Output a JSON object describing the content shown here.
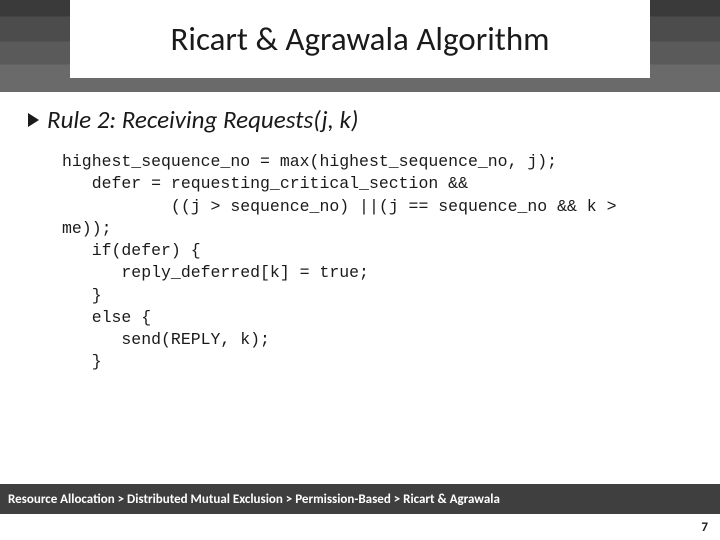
{
  "title": "Ricart & Agrawala Algorithm",
  "subhead": "Rule 2: Receiving Requests(j, k)",
  "code": "highest_sequence_no = max(highest_sequence_no, j);\n   defer = requesting_critical_section &&\n           ((j > sequence_no) ||(j == sequence_no && k >\nme));\n   if(defer) {\n      reply_deferred[k] = true;\n   }\n   else {\n      send(REPLY, k);\n   }",
  "breadcrumb": "Resource Allocation > Distributed Mutual Exclusion > Permission-Based > Ricart & Agrawala",
  "page_number": "7"
}
